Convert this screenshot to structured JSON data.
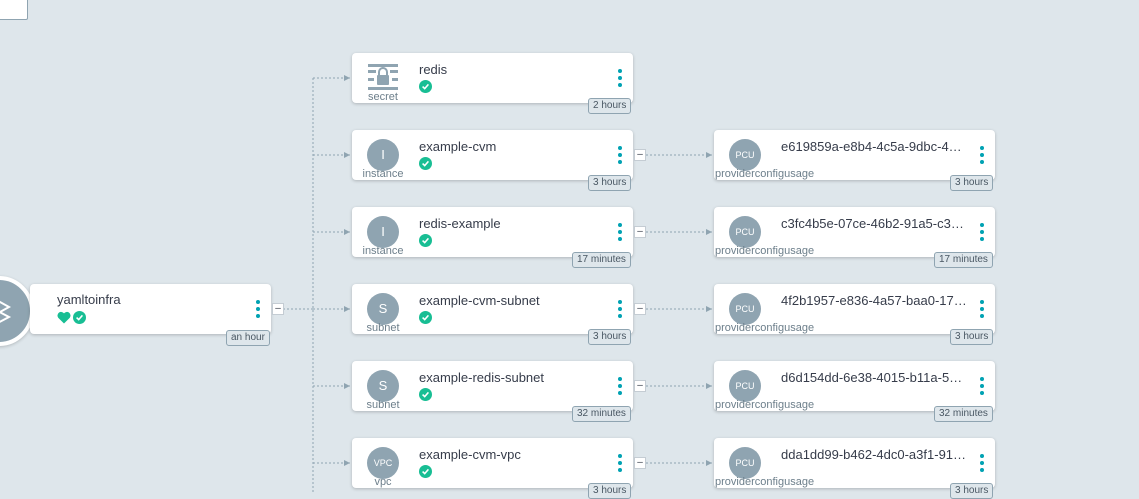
{
  "app": {
    "name": "yamltoinfra",
    "age": "an hour"
  },
  "resources": [
    {
      "kind_label": "secret",
      "name": "redis",
      "age": "2 hours",
      "icon": "lock-icon"
    },
    {
      "kind_label": "instance",
      "name": "example-cvm",
      "age": "3 hours",
      "icon_text": "I"
    },
    {
      "kind_label": "instance",
      "name": "redis-example",
      "age": "17 minutes",
      "icon_text": "I"
    },
    {
      "kind_label": "subnet",
      "name": "example-cvm-subnet",
      "age": "3 hours",
      "icon_text": "S"
    },
    {
      "kind_label": "subnet",
      "name": "example-redis-subnet",
      "age": "32 minutes",
      "icon_text": "S"
    },
    {
      "kind_label": "vpc",
      "name": "example-cvm-vpc",
      "age": "3 hours",
      "icon_text": "VPC"
    }
  ],
  "usages": [
    {
      "kind_label": "providerconfigusage",
      "icon_text": "PCU",
      "name": "e619859a-e8b4-4c5a-9dbc-4…",
      "age": "3 hours"
    },
    {
      "kind_label": "providerconfigusage",
      "icon_text": "PCU",
      "name": "c3fc4b5e-07ce-46b2-91a5-c3…",
      "age": "17 minutes"
    },
    {
      "kind_label": "providerconfigusage",
      "icon_text": "PCU",
      "name": "4f2b1957-e836-4a57-baa0-17…",
      "age": "3 hours"
    },
    {
      "kind_label": "providerconfigusage",
      "icon_text": "PCU",
      "name": "d6d154dd-6e38-4015-b11a-5…",
      "age": "32 minutes"
    },
    {
      "kind_label": "providerconfigusage",
      "icon_text": "PCU",
      "name": "dda1dd99-b462-4dc0-a3f1-91…",
      "age": "3 hours"
    }
  ],
  "collapse_symbol": "–",
  "colors": {
    "accent": "#00a2b3",
    "healthy": "#18be94",
    "icon_bg": "#8fa4b1",
    "canvas_bg": "#dee6eb"
  }
}
